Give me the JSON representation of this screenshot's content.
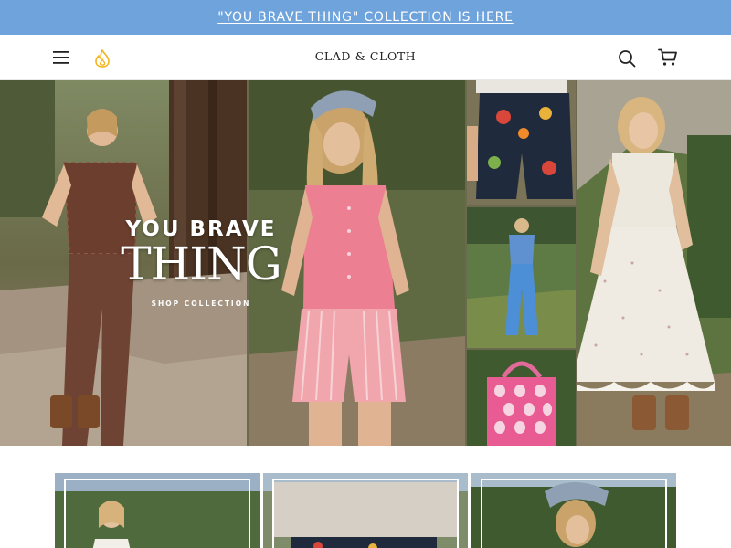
{
  "announcement": {
    "text": "\"YOU BRAVE THING\" COLLECTION IS HERE"
  },
  "header": {
    "brand": "CLAD & CLOTH",
    "icons": [
      "menu-icon",
      "flame-icon",
      "search-icon",
      "cart-icon"
    ]
  },
  "hero": {
    "line1": "YOU BRAVE",
    "line2": "THING",
    "cta": "SHOP COLLECTION"
  },
  "colors": {
    "announcement_bg": "#6fa3dc",
    "flame": "#f2b41d"
  }
}
